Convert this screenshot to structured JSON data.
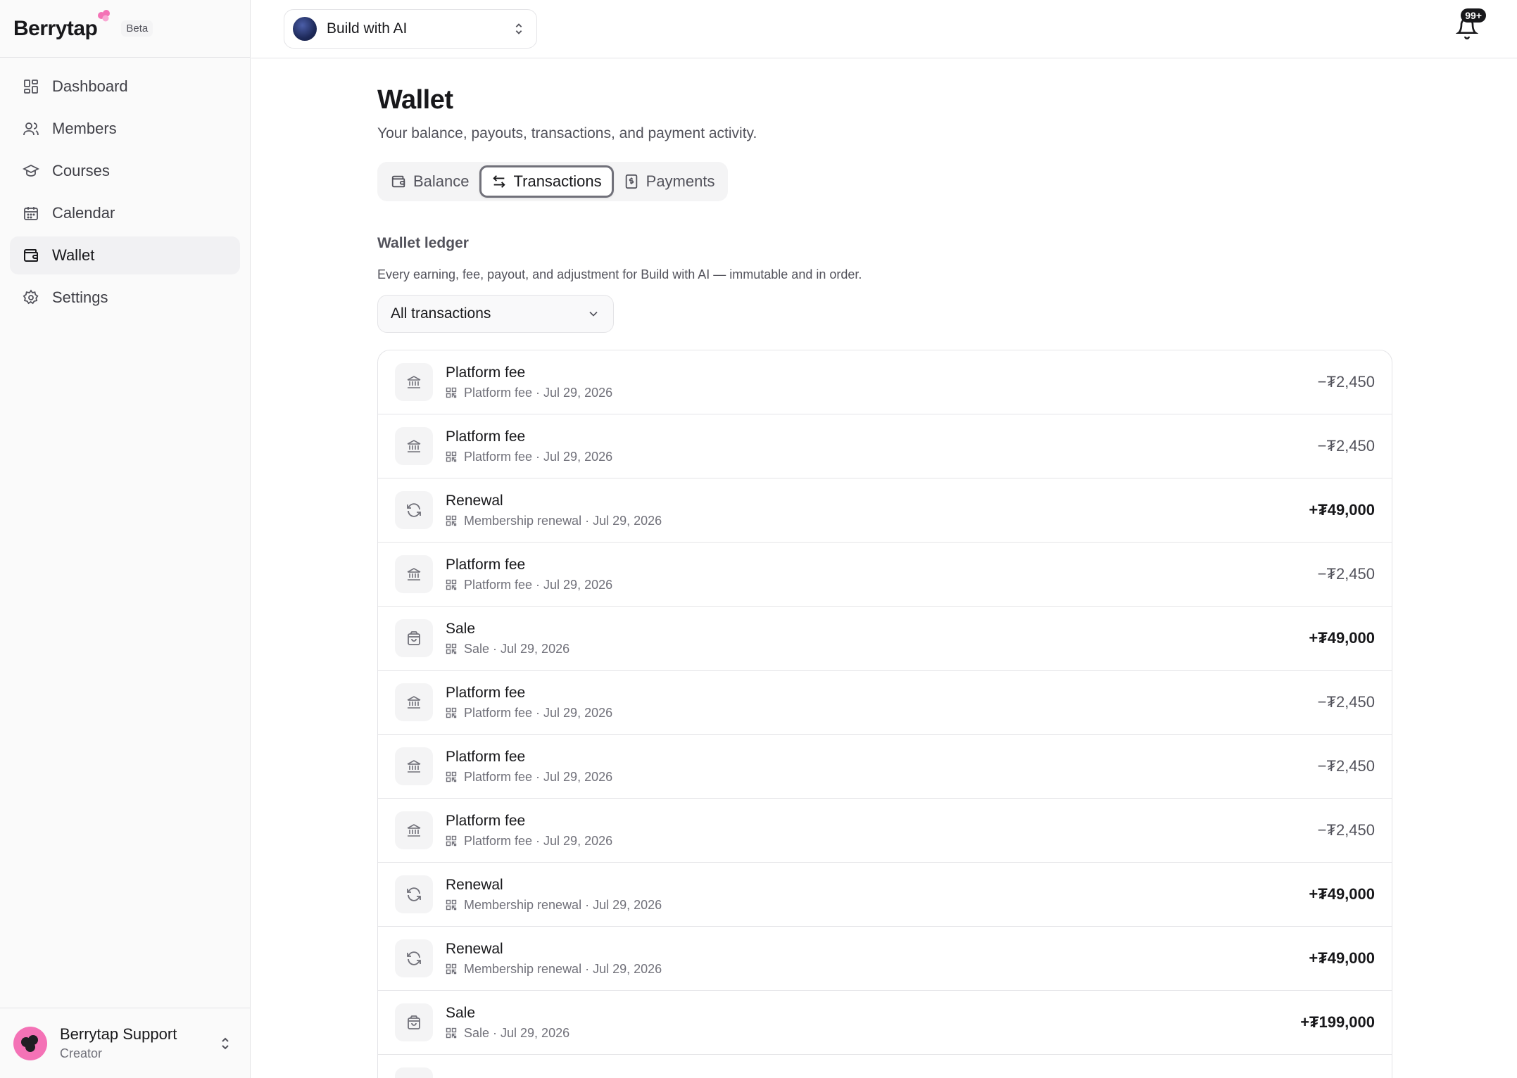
{
  "brand": {
    "name": "Berrytap",
    "badge": "Beta"
  },
  "sidebar": {
    "items": [
      {
        "label": "Dashboard",
        "icon": "dashboard-icon",
        "active": false
      },
      {
        "label": "Members",
        "icon": "members-icon",
        "active": false
      },
      {
        "label": "Courses",
        "icon": "courses-icon",
        "active": false
      },
      {
        "label": "Calendar",
        "icon": "calendar-icon",
        "active": false
      },
      {
        "label": "Wallet",
        "icon": "wallet-icon",
        "active": true
      },
      {
        "label": "Settings",
        "icon": "settings-icon",
        "active": false
      }
    ]
  },
  "user": {
    "name": "Berrytap Support",
    "role": "Creator"
  },
  "topbar": {
    "space_name": "Build with AI",
    "notification_badge": "99+"
  },
  "page": {
    "title": "Wallet",
    "subtitle": "Your balance, payouts, transactions, and payment activity.",
    "tabs": [
      {
        "label": "Balance",
        "active": false
      },
      {
        "label": "Transactions",
        "active": true
      },
      {
        "label": "Payments",
        "active": false
      }
    ]
  },
  "ledger": {
    "title": "Wallet ledger",
    "description": "Every earning, fee, payout, and adjustment for Build with AI — immutable and in order.",
    "filter": "All transactions",
    "rows": [
      {
        "title": "Platform fee",
        "meta": "Platform fee · Jul 29, 2026",
        "amount": "−₮2,450",
        "kind": "fee"
      },
      {
        "title": "Platform fee",
        "meta": "Platform fee · Jul 29, 2026",
        "amount": "−₮2,450",
        "kind": "fee"
      },
      {
        "title": "Renewal",
        "meta": "Membership renewal · Jul 29, 2026",
        "amount": "+₮49,000",
        "kind": "renewal"
      },
      {
        "title": "Platform fee",
        "meta": "Platform fee · Jul 29, 2026",
        "amount": "−₮2,450",
        "kind": "fee"
      },
      {
        "title": "Sale",
        "meta": "Sale · Jul 29, 2026",
        "amount": "+₮49,000",
        "kind": "sale"
      },
      {
        "title": "Platform fee",
        "meta": "Platform fee · Jul 29, 2026",
        "amount": "−₮2,450",
        "kind": "fee"
      },
      {
        "title": "Platform fee",
        "meta": "Platform fee · Jul 29, 2026",
        "amount": "−₮2,450",
        "kind": "fee"
      },
      {
        "title": "Platform fee",
        "meta": "Platform fee · Jul 29, 2026",
        "amount": "−₮2,450",
        "kind": "fee"
      },
      {
        "title": "Renewal",
        "meta": "Membership renewal · Jul 29, 2026",
        "amount": "+₮49,000",
        "kind": "renewal"
      },
      {
        "title": "Renewal",
        "meta": "Membership renewal · Jul 29, 2026",
        "amount": "+₮49,000",
        "kind": "renewal"
      },
      {
        "title": "Sale",
        "meta": "Sale · Jul 29, 2026",
        "amount": "+₮199,000",
        "kind": "sale"
      },
      {
        "title": "",
        "meta": "",
        "amount": "",
        "kind": "fee"
      }
    ]
  }
}
